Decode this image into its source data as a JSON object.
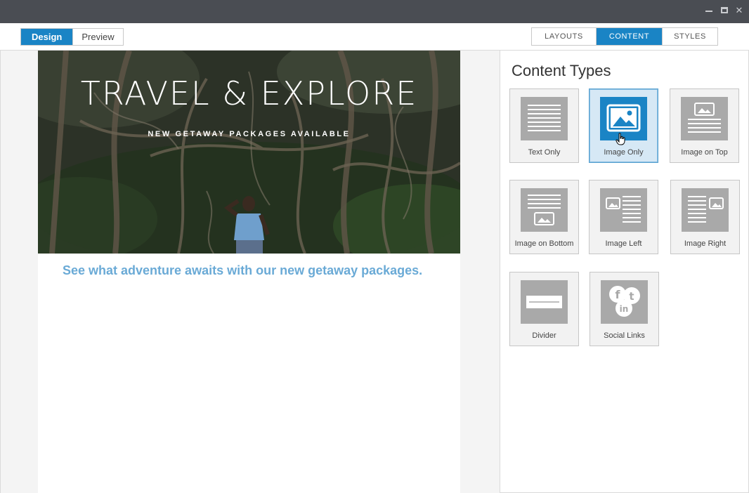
{
  "window": {
    "controls": [
      "minimize-icon",
      "maximize-icon",
      "close-icon"
    ],
    "close_glyph": "✕"
  },
  "toolbar": {
    "modes": {
      "design": "Design",
      "preview": "Preview",
      "active": "Design"
    },
    "tabs": [
      {
        "label": "LAYOUTS",
        "active": false
      },
      {
        "label": "CONTENT",
        "active": true
      },
      {
        "label": "STYLES",
        "active": false
      }
    ],
    "accent_color": "#1a84c5"
  },
  "email": {
    "hero_title": "TRAVEL & EXPLORE",
    "hero_subtitle": "NEW GETAWAY PACKAGES AVAILABLE",
    "tagline": "See what adventure awaits with our new getaway packages.",
    "tagline_color": "#6aaad6"
  },
  "panel": {
    "title": "Content Types",
    "items": [
      {
        "label": "Text Only",
        "icon": "text-only-icon",
        "selected": false
      },
      {
        "label": "Image Only",
        "icon": "image-only-icon",
        "selected": true
      },
      {
        "label": "Image on Top",
        "icon": "image-on-top-icon",
        "selected": false
      },
      {
        "label": "Image on Bottom",
        "icon": "image-on-bottom-icon",
        "selected": false
      },
      {
        "label": "Image Left",
        "icon": "image-left-icon",
        "selected": false
      },
      {
        "label": "Image Right",
        "icon": "image-right-icon",
        "selected": false
      },
      {
        "label": "Divider",
        "icon": "divider-icon",
        "selected": false
      },
      {
        "label": "Social Links",
        "icon": "social-links-icon",
        "selected": false
      }
    ]
  }
}
